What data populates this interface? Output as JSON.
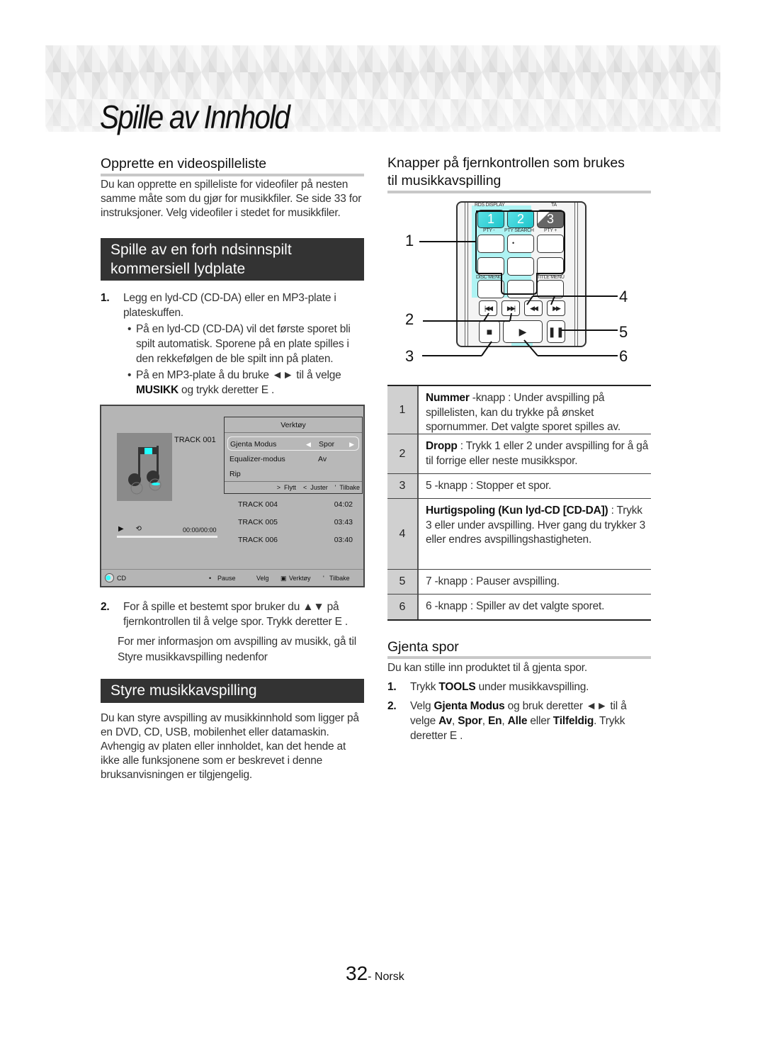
{
  "page": {
    "title": "Spille av Innhold",
    "page_number": "32",
    "language": "- Norsk"
  },
  "left": {
    "section1": {
      "heading": "Opprette en videospilleliste",
      "body": "Du kan opprette en spilleliste for videofiler på nesten samme måte som du gjør for musikkfiler. Se side 33 for instruksjoner. Velg videofiler i stedet for musikkfiler."
    },
    "section2": {
      "bar_line1": "Spille av en forh ndsinnspilt",
      "bar_line2": "kommersiell lydplate",
      "step1_num": "1.",
      "step1_text": "Legg en lyd-CD (CD-DA) eller en MP3-plate i plateskuffen.",
      "bullet1": "På en lyd-CD (CD-DA) vil det første sporet bli spilt automatisk. Sporene på en plate spilles i den rekkefølgen de ble spilt inn på platen.",
      "bullet2_pre": "På en MP3-plate å du bruke ◄► til å velge ",
      "bullet2_bold": "MUSIKK",
      "bullet2_post": " og trykk deretter E   .",
      "step2_num": "2.",
      "step2_text": "For å spille et bestemt spor bruker du ▲▼ på fjernkontrollen til å velge spor. Trykk deretter E   .",
      "more_info": "For mer informasjon om avspilling av musikk, gå til Styre musikkavspilling nedenfor"
    },
    "screen": {
      "current_track": "TRACK 001",
      "timecode": "00:00/00:00",
      "progress_percent": 0,
      "tools": {
        "title": "Verktøy",
        "rows": [
          {
            "label": "Gjenta Modus",
            "value": "Spor",
            "selected": true
          },
          {
            "label": "Equalizer-modus",
            "value": "Av",
            "selected": false
          },
          {
            "label": "Rip",
            "value": "",
            "selected": false
          }
        ],
        "footer": ">  Flytt    <  Juster    '  Tilbake"
      },
      "tracks": [
        {
          "name": "TRACK 004",
          "duration": "04:02"
        },
        {
          "name": "TRACK 005",
          "duration": "03:43"
        },
        {
          "name": "TRACK 006",
          "duration": "03:40"
        }
      ],
      "bottom_bar": {
        "source": "CD",
        "pause": "Pause",
        "select": "Velg",
        "tools": "Verktøy",
        "back": "Tilbake"
      }
    },
    "section3": {
      "bar": "Styre musikkavspilling",
      "body": "Du kan styre avspilling av musikkinnhold som ligger på en DVD, CD, USB, mobilenhet eller datamaskin. Avhengig av platen eller innholdet, kan det hende at ikke alle funksjonene som er beskrevet i denne bruksanvisningen er tilgjengelig."
    }
  },
  "right": {
    "section1": {
      "heading_line1": "Knapper på fjernkontrollen som brukes",
      "heading_line2": "til musikkavspilling"
    },
    "remote": {
      "labels": {
        "rds_display": "RDS DISPLAY",
        "ta": "TA",
        "pty_minus": "PTY -",
        "pty_search": "PTY SEARCH",
        "pty_plus": "PTY +",
        "disc_menu": "DISC MENU",
        "title_menu": "TITLE MENU"
      },
      "num_buttons": [
        "1",
        "2",
        "3"
      ],
      "callouts": [
        "1",
        "2",
        "3",
        "4",
        "5",
        "6"
      ]
    },
    "table": [
      {
        "num": "1",
        "bold": "Nummer",
        "text": " -knapp : Under avspilling på spillelisten, kan du trykke på ønsket spornummer. Det valgte sporet spilles av."
      },
      {
        "num": "2",
        "bold": "Dropp",
        "text": " : Trykk 1    eller 2    under avspilling for å gå til forrige eller neste musikkspor."
      },
      {
        "num": "3",
        "bold": "",
        "text": "5    -knapp : Stopper et spor."
      },
      {
        "num": "4",
        "bold": "Hurtigspoling (Kun lyd-CD [CD-DA])",
        "text": " : Trykk 3    eller      under avspilling. Hver gang du trykker 3    eller      endres avspillingshastigheten."
      },
      {
        "num": "5",
        "bold": "",
        "text": "7    -knapp : Pauser avspilling."
      },
      {
        "num": "6",
        "bold": "",
        "text": "6    -knapp : Spiller av det valgte sporet."
      }
    ],
    "section2": {
      "heading": "Gjenta spor",
      "intro": "Du kan stille inn produktet til å gjenta spor.",
      "step1_num": "1.",
      "step1_pre": "Trykk ",
      "step1_bold": "TOOLS",
      "step1_post": " under musikkavspilling.",
      "step2_num": "2.",
      "step2_parts": {
        "a": "Velg ",
        "b": "Gjenta Modus",
        "c": " og bruk deretter ◄► til å velge ",
        "d": "Av",
        "e": ", ",
        "f": "Spor",
        "g": ", ",
        "h": "En",
        "i": ", ",
        "j": "Alle",
        "k": " eller ",
        "l": "Tilfeldig",
        "m": ". Trykk deretter E   ."
      }
    }
  }
}
